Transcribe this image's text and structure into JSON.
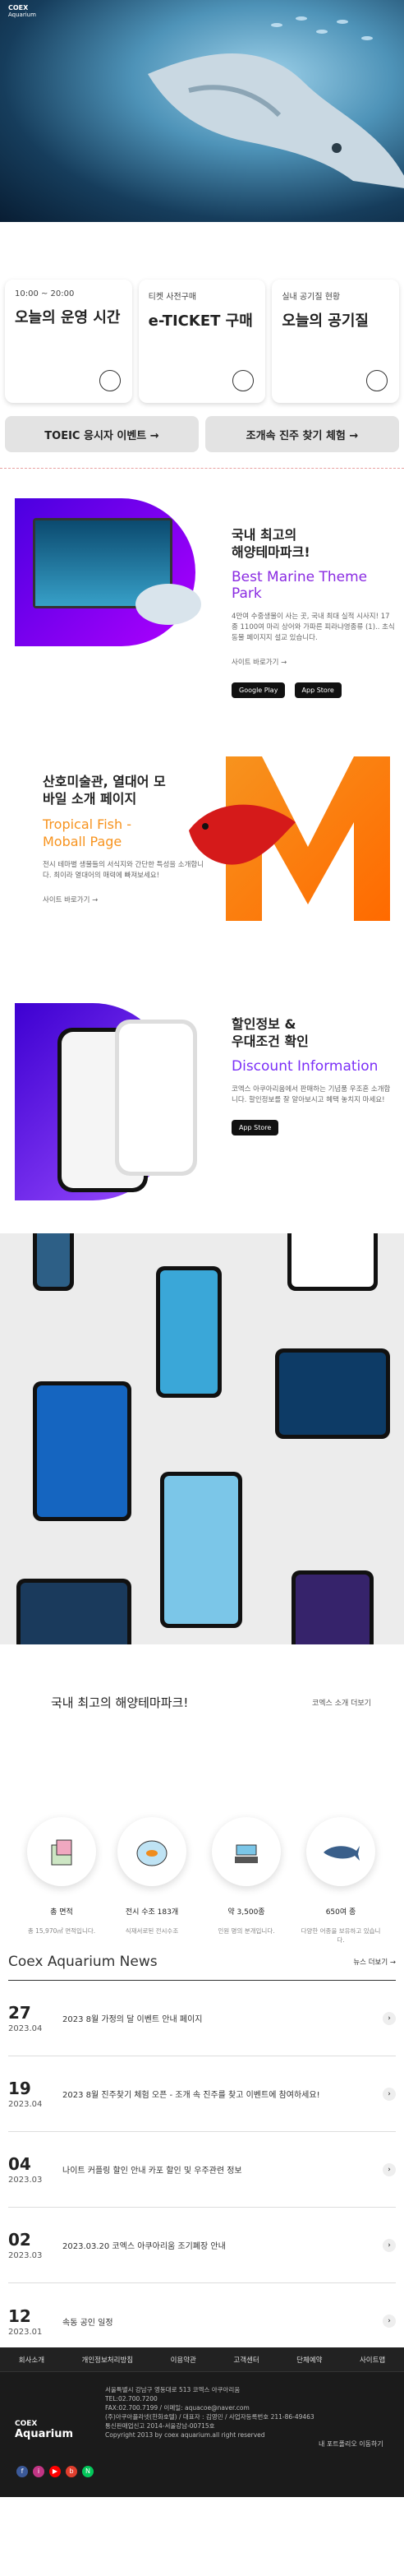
{
  "hero": {
    "logo_line1": "COEX",
    "logo_line2": "Aquarium"
  },
  "info_cards": [
    {
      "small": "10:00 ~ 20:00",
      "big": "오늘의 운영 시간",
      "icon": "clock-icon"
    },
    {
      "small": "티켓 사전구매",
      "big": "e-TICKET 구매",
      "icon": "search-icon"
    },
    {
      "small": "실내 공기질 현황",
      "big": "오늘의 공기질",
      "icon": "air-icon"
    }
  ],
  "quick_buttons": [
    {
      "label": "TOEIC 응시자 이벤트 →"
    },
    {
      "label": "조개속 진주 찾기 체험 →"
    }
  ],
  "section1": {
    "letter": "D",
    "title_line1": "국내 최고의",
    "title_line2": "해양테마파크!",
    "subtitle": "Best Marine Theme Park",
    "desc": "4만여 수중생물이 사는 곳, 국내 최대 실적 시사지! 17종 1100여 마리 상어와 가파른 피라냐영종류 (1).. 초식동물 페이지지 설교 있습니다.",
    "more": "사이트 바로가기 →",
    "store1": "Google Play",
    "store2": "App Store",
    "accent": "#8a2be2"
  },
  "section2": {
    "letter": "M",
    "title_line1": "산호미술관, 열대어 모",
    "title_line2": "바일 소개 페이지",
    "subtitle_line1": "Tropical Fish -",
    "subtitle_line2": "Moball Page",
    "desc": "전시 테마별 생물들의 서식지와 간단한 특성을 소개합니다. 최이라 열대어의 매력에 빠져보세요!",
    "more": "사이트 바로가기 →",
    "accent": "#f7931e"
  },
  "section3": {
    "letter": "D",
    "title_line1": "할인정보 &",
    "title_line2": "우대조건 확인",
    "subtitle": "Discount Information",
    "desc": "코엑스 아쿠아리움에서 판매하는 기념품 우조혼 소개합니다. 할인정보를 잘 알아보시고 혜택 놓치지 마세요!",
    "store": "App Store",
    "accent": "#7b2ff7"
  },
  "stats": {
    "title": "국내 최고의 해양테마파크!",
    "link": "코엑스 소개 더보기",
    "items": [
      {
        "label": "총 면적",
        "caption": "총 15,970㎡ 면적입니다.",
        "icon": "building-icon"
      },
      {
        "label": "전시 수조 183개",
        "caption": "식재서로된 전시수조",
        "icon": "fishbowl-icon"
      },
      {
        "label": "약 3,500종",
        "caption": "인원 명의 분개입니다.",
        "icon": "scale-icon"
      },
      {
        "label": "650여 종",
        "caption": "다양한 어종을 보유하고 있습니다.",
        "icon": "shark-icon"
      }
    ]
  },
  "news": {
    "title": "Coex Aquarium News",
    "more": "뉴스 더보기 →",
    "items": [
      {
        "day": "27",
        "ym": "2023.04",
        "text": "2023 8월 가정의 달 이벤트 안내 페이지"
      },
      {
        "day": "19",
        "ym": "2023.04",
        "text": "2023 8월 진주찾기 체험 오픈 - 조개 속 진주를 찾고 이벤트에 참여하세요!"
      },
      {
        "day": "04",
        "ym": "2023.03",
        "text": "나이트 커플링 할인 안내 카포 할인 및 우주관련 정보"
      },
      {
        "day": "02",
        "ym": "2023.03",
        "text": "2023.03.20 코엑스 아쿠아리움 조기폐장 안내"
      },
      {
        "day": "12",
        "ym": "2023.01",
        "text": "속동 공인 일정"
      }
    ]
  },
  "footer": {
    "nav": [
      "회사소개",
      "개인정보처리방침",
      "이용약관",
      "고객센터",
      "단체예약",
      "사이트맵"
    ],
    "info_lines": [
      "서울특별시 강남구 영동대로 513 코엑스 아쿠아리움",
      "TEL:02.700.7200",
      "FAX:02.700.7199 / 이메일: aquacoe@naver.com",
      "(주)아쿠아플라넷(한화호텔) / 대표자 : 김영민 / 사업자등록번호 211-86-49463",
      "통신판매업신고 2014-서울강남-00715호",
      "Copyright 2013 by coex aquarium.all right reserved"
    ],
    "logo_line1": "COEX",
    "logo_line2": "Aquarium",
    "right_text": "내 포트폴리오 이동하기"
  }
}
